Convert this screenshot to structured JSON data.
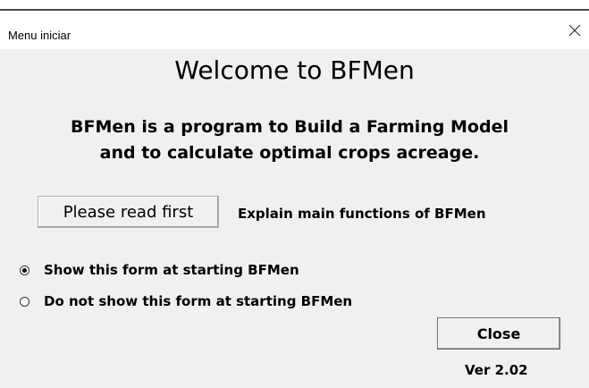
{
  "window": {
    "title": "Menu iniciar",
    "close_icon": "close-icon"
  },
  "main": {
    "welcome": "Welcome to BFMen",
    "description_line1": "BFMen is a program to Build a Farming Model",
    "description_line2": "and to calculate optimal crops acreage.",
    "read_button_label": "Please read first",
    "read_button_note": "Explain main functions of BFMen"
  },
  "options": {
    "show_form_label": "Show this form at starting BFMen",
    "hide_form_label": "Do not show this form at starting BFMen",
    "selected": "show_form"
  },
  "footer": {
    "close_label": "Close",
    "version": "Ver 2.02"
  },
  "colors": {
    "background": "#f0f0f0",
    "titlebar": "#ffffff",
    "border": "#4a4a4a"
  }
}
